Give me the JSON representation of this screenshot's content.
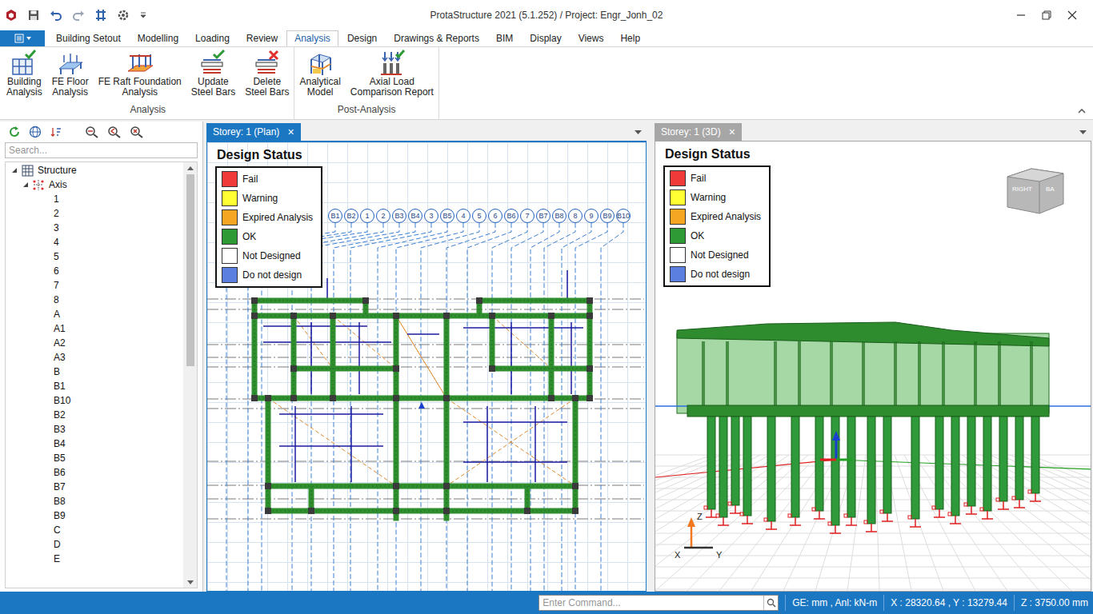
{
  "window": {
    "title": "ProtaStructure 2021 (5.1.252) / Project: Engr_Jonh_02"
  },
  "menu_tabs": [
    {
      "label": "Building Setout",
      "selected": false
    },
    {
      "label": "Modelling",
      "selected": false
    },
    {
      "label": "Loading",
      "selected": false
    },
    {
      "label": "Review",
      "selected": false
    },
    {
      "label": "Analysis",
      "selected": true
    },
    {
      "label": "Design",
      "selected": false
    },
    {
      "label": "Drawings & Reports",
      "selected": false
    },
    {
      "label": "BIM",
      "selected": false
    },
    {
      "label": "Display",
      "selected": false
    },
    {
      "label": "Views",
      "selected": false
    },
    {
      "label": "Help",
      "selected": false
    }
  ],
  "ribbon": {
    "groups": [
      {
        "label": "Analysis",
        "buttons": [
          {
            "lines": [
              "Building",
              "Analysis"
            ]
          },
          {
            "lines": [
              "FE Floor",
              "Analysis"
            ]
          },
          {
            "lines": [
              "FE Raft Foundation",
              "Analysis"
            ]
          },
          {
            "lines": [
              "Update",
              "Steel Bars"
            ]
          },
          {
            "lines": [
              "Delete",
              "Steel Bars"
            ]
          }
        ]
      },
      {
        "label": "Post-Analysis",
        "buttons": [
          {
            "lines": [
              "Analytical",
              "Model"
            ]
          },
          {
            "lines": [
              "Axial Load",
              "Comparison Report"
            ]
          }
        ]
      }
    ]
  },
  "sidebar": {
    "search": {
      "placeholder": "Search..."
    },
    "tree": {
      "label": "Structure",
      "expanded": true,
      "children": [
        {
          "label": "Axis",
          "expanded": true,
          "children": [
            {
              "label": "1"
            },
            {
              "label": "2"
            },
            {
              "label": "3"
            },
            {
              "label": "4"
            },
            {
              "label": "5"
            },
            {
              "label": "6"
            },
            {
              "label": "7"
            },
            {
              "label": "8"
            },
            {
              "label": "A"
            },
            {
              "label": "A1"
            },
            {
              "label": "A2"
            },
            {
              "label": "A3"
            },
            {
              "label": "B"
            },
            {
              "label": "B1"
            },
            {
              "label": "B10"
            },
            {
              "label": "B2"
            },
            {
              "label": "B3"
            },
            {
              "label": "B4"
            },
            {
              "label": "B5"
            },
            {
              "label": "B6"
            },
            {
              "label": "B7"
            },
            {
              "label": "B8"
            },
            {
              "label": "B9"
            },
            {
              "label": "C"
            },
            {
              "label": "D"
            },
            {
              "label": "E"
            }
          ]
        }
      ]
    }
  },
  "views": [
    {
      "tab": {
        "label": "Storey: 1 (Plan)",
        "close": "×",
        "selected": true
      },
      "legend": {
        "title": "Design Status",
        "items": [
          {
            "label": "Fail",
            "color": "#f03a3a"
          },
          {
            "label": "Warning",
            "color": "#ffff33"
          },
          {
            "label": "Expired Analysis",
            "color": "#f5a623"
          },
          {
            "label": "OK",
            "color": "#2e9a35"
          },
          {
            "label": "Not Designed",
            "color": "#ffffff"
          },
          {
            "label": "Do not design",
            "color": "#5b7fe0"
          }
        ]
      },
      "axes": [
        "B1",
        "B2",
        "1",
        "2",
        "B3",
        "B4",
        "3",
        "B5",
        "4",
        "5",
        "6",
        "B6",
        "7",
        "B7",
        "B8",
        "8",
        "9",
        "B9",
        "B10"
      ]
    },
    {
      "tab": {
        "label": "Storey: 1 (3D)",
        "close": "×",
        "selected": false
      },
      "legend": {
        "title": "Design Status",
        "items": [
          {
            "label": "Fail",
            "color": "#f03a3a"
          },
          {
            "label": "Warning",
            "color": "#ffff33"
          },
          {
            "label": "Expired Analysis",
            "color": "#f5a623"
          },
          {
            "label": "OK",
            "color": "#2e9a35"
          },
          {
            "label": "Not Designed",
            "color": "#ffffff"
          },
          {
            "label": "Do not design",
            "color": "#5b7fe0"
          }
        ]
      },
      "view_cube": [
        "RIGHT",
        "BA"
      ],
      "gizmo": [
        "X",
        "Y",
        "Z"
      ]
    }
  ],
  "status_bar": {
    "command": {
      "placeholder": "Enter Command..."
    },
    "units": "GE: mm , Anl: kN-m",
    "xy": "X : 28320.64 , Y : 13279.44",
    "z": "Z : 3750.00 mm"
  }
}
